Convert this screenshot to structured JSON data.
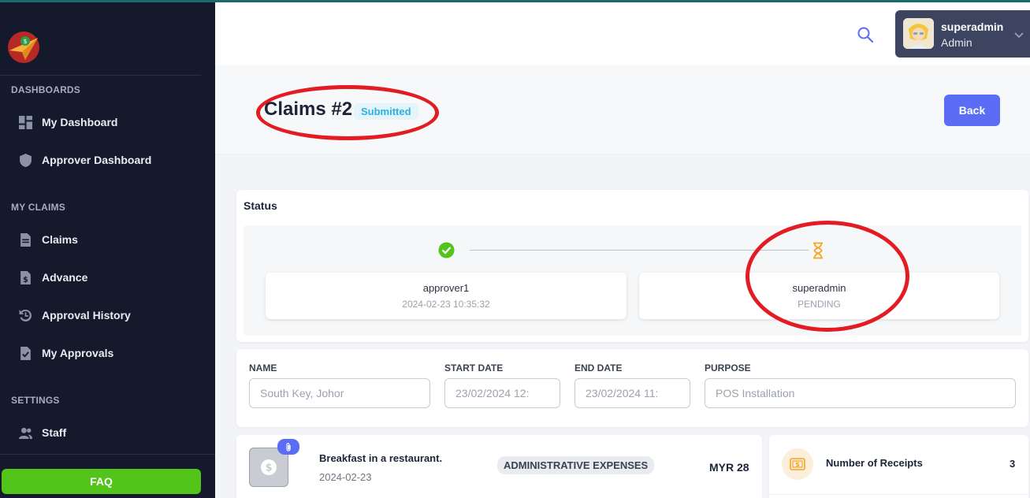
{
  "sidebar": {
    "sections": [
      {
        "title": "DASHBOARDS"
      },
      {
        "title": "MY CLAIMS"
      },
      {
        "title": "SETTINGS"
      }
    ],
    "items": [
      {
        "label": "My Dashboard",
        "icon": "dashboard-icon"
      },
      {
        "label": "Approver Dashboard",
        "icon": "shield-icon"
      },
      {
        "label": "Claims",
        "icon": "document-icon"
      },
      {
        "label": "Advance",
        "icon": "dollar-document-icon"
      },
      {
        "label": "Approval History",
        "icon": "history-icon"
      },
      {
        "label": "My Approvals",
        "icon": "check-document-icon"
      },
      {
        "label": "Staff",
        "icon": "users-icon"
      }
    ],
    "faq_label": "FAQ"
  },
  "header": {
    "user": {
      "name": "superadmin",
      "role": "Admin"
    }
  },
  "page": {
    "title": "Claims #2",
    "status": "Submitted",
    "back_label": "Back"
  },
  "status_card": {
    "title": "Status",
    "steps": [
      {
        "name": "approver1",
        "detail": "2024-02-23 10:35:32",
        "state": "done"
      },
      {
        "name": "superadmin",
        "detail": "PENDING",
        "state": "pending"
      }
    ]
  },
  "form": {
    "name": {
      "label": "NAME",
      "value": "South Key, Johor"
    },
    "start_date": {
      "label": "START DATE",
      "value": "23/02/2024 12:"
    },
    "end_date": {
      "label": "END DATE",
      "value": "23/02/2024 11:"
    },
    "purpose": {
      "label": "PURPOSE",
      "value": "POS Installation"
    }
  },
  "expense": {
    "title": "Breakfast in a restaurant.",
    "date": "2024-02-23",
    "category": "ADMINISTRATIVE EXPENSES",
    "amount": "MYR 28"
  },
  "receipts": {
    "label": "Number of Receipts",
    "count": "3"
  },
  "colors": {
    "sidebar_bg": "#141a2c",
    "primary": "#5b6cf5",
    "success": "#52c41a",
    "pending": "#f5a623",
    "annotation": "#e31b23"
  }
}
